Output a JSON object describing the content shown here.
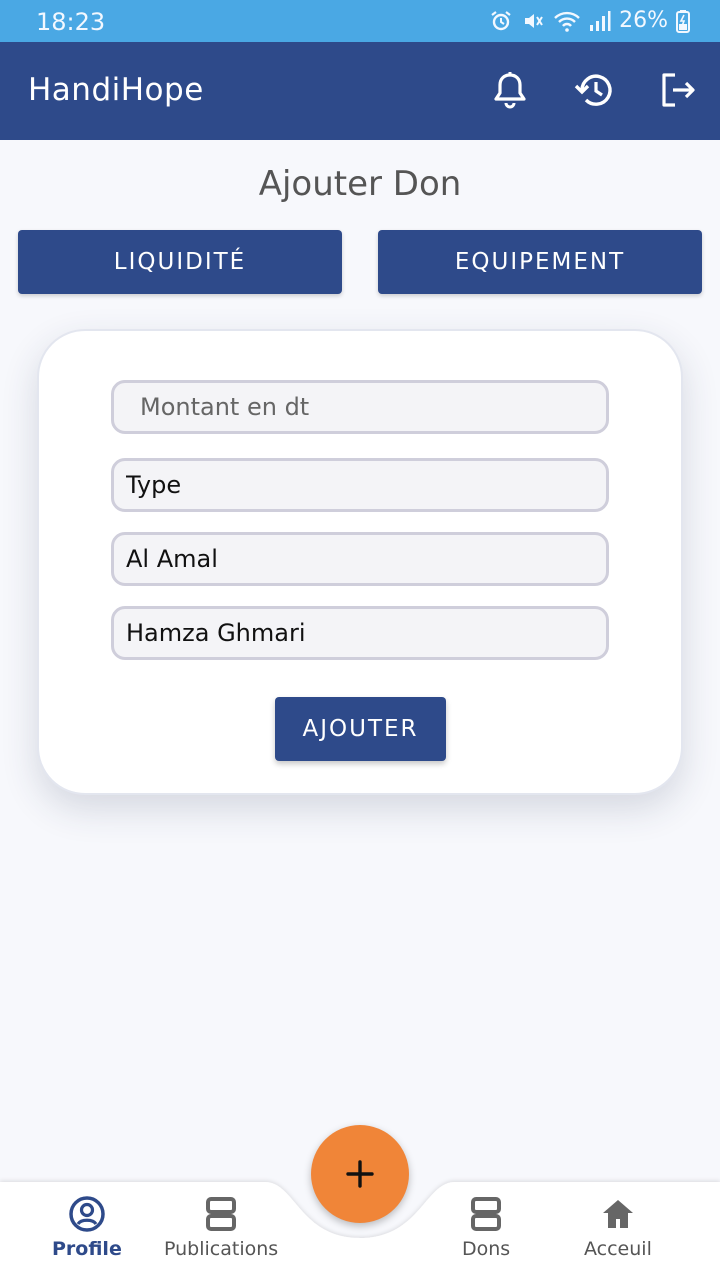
{
  "status_bar": {
    "time": "18:23",
    "battery": "26%",
    "icons": [
      "alarm-icon",
      "mute-icon",
      "wifi-icon",
      "signal-icon",
      "battery-charging-icon"
    ]
  },
  "app_bar": {
    "title": "HandiHope",
    "actions": [
      "bell-icon",
      "history-icon",
      "logout-icon"
    ]
  },
  "page": {
    "title": "Ajouter Don",
    "type_buttons": {
      "liquidite": "LIQUIDITÉ",
      "equipement": "EQUIPEMENT"
    }
  },
  "form": {
    "montant_placeholder": "Montant en dt",
    "type_value": "Type",
    "association_value": "Al Amal",
    "donor_value": "Hamza Ghmari",
    "submit_label": "AJOUTER"
  },
  "bottom_nav": {
    "items": [
      {
        "label": "Profile",
        "icon": "profile-icon",
        "active": true
      },
      {
        "label": "Publications",
        "icon": "publications-icon",
        "active": false
      },
      {
        "label": "Dons",
        "icon": "dons-icon",
        "active": false
      },
      {
        "label": "Acceuil",
        "icon": "home-icon",
        "active": false
      }
    ],
    "fab_label": "+"
  },
  "colors": {
    "status_bar": "#4aa8e4",
    "primary": "#2e4a8a",
    "accent": "#f08538",
    "background": "#f7f8fc"
  }
}
